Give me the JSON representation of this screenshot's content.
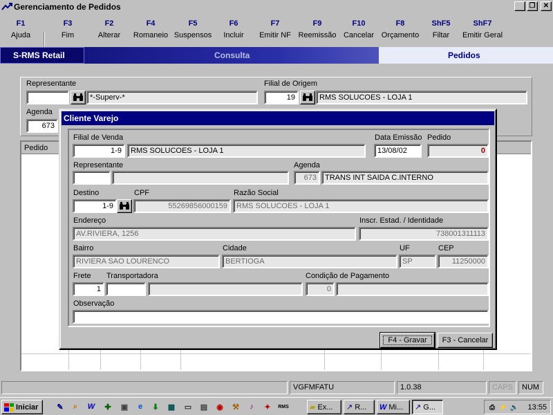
{
  "window": {
    "title": "Gerenciamento de Pedidos",
    "app_icon": "rms-arrow-icon"
  },
  "toolbar": {
    "keys": [
      {
        "key": "F1",
        "label": "Ajuda"
      },
      {
        "key": "F3",
        "label": "Fim"
      },
      {
        "key": "F2",
        "label": "Alterar"
      },
      {
        "key": "F4",
        "label": "Romaneio"
      },
      {
        "key": "F5",
        "label": "Suspensos"
      },
      {
        "key": "F6",
        "label": "Incluir"
      },
      {
        "key": "F7",
        "label": "Emitir NF"
      },
      {
        "key": "F9",
        "label": "Reemissão"
      },
      {
        "key": "F10",
        "label": "Cancelar"
      },
      {
        "key": "F8",
        "label": "Orçamento"
      },
      {
        "key": "ShF5",
        "label": "Filtar"
      },
      {
        "key": "ShF7",
        "label": "Emitir Geral"
      }
    ]
  },
  "banner": {
    "brand": "S-RMS Retail",
    "mode": "Consulta",
    "section": "Pedidos"
  },
  "background_form": {
    "representante_label": "Representante",
    "representante_value": "*-Superv-*",
    "filial_origem_label": "Filial de Origem",
    "filial_origem_code": "19",
    "filial_origem_name": "RMS SOLUCOES - LOJA 1",
    "agenda_label": "Agenda",
    "agenda_value": "673",
    "grid_headers": [
      "Pedido",
      "ão"
    ]
  },
  "dialog": {
    "title": "Cliente Varejo",
    "filial_venda_label": "Filial de Venda",
    "filial_venda_code": "1-9",
    "filial_venda_name": "RMS SOLUCOES - LOJA 1",
    "data_emissao_label": "Data Emissão",
    "data_emissao_value": "13/08/02",
    "pedido_label": "Pedido",
    "pedido_value": "0",
    "representante_label": "Representante",
    "agenda_label": "Agenda",
    "agenda_code": "673",
    "agenda_name": "TRANS INT SAIDA C.INTERNO",
    "destino_label": "Destino",
    "destino_value": "1-9",
    "cpf_label": "CPF",
    "cpf_value": "55269856000159",
    "razao_label": "Razão Social",
    "razao_value": "RMS SOLUCOES - LOJA 1",
    "endereco_label": "Endereço",
    "endereco_value": "AV.RIVIERA, 1256",
    "inscr_label": "Inscr. Estad. / Identidade",
    "inscr_value": "738001311113",
    "bairro_label": "Bairro",
    "bairro_value": "RIVIERA SAO LOURENCO",
    "cidade_label": "Cidade",
    "cidade_value": "BERTIOGA",
    "uf_label": "UF",
    "uf_value": "SP",
    "cep_label": "CEP",
    "cep_value": "11250000",
    "frete_label": "Frete",
    "frete_value": "1",
    "transportadora_label": "Transportadora",
    "condicao_label": "Condição de Pagamento",
    "condicao_code": "0",
    "observacao_label": "Observação",
    "save_label": "F4 - Gravar",
    "cancel_label": "F3 - Cancelar"
  },
  "statusbar": {
    "program": "VGFMFATU",
    "version": "1.0.38",
    "caps": "CAPS",
    "num": "NUM"
  },
  "taskbar": {
    "start_label": "Iniciar",
    "tasks": [
      "Ex...",
      "R...",
      "Mi...",
      "G..."
    ],
    "time": "13:55"
  },
  "colors": {
    "title_bar": "#000080",
    "banner_dark": "#08086a",
    "pedido_value": "#8b0000",
    "window_bg": "#c0c0c0"
  }
}
